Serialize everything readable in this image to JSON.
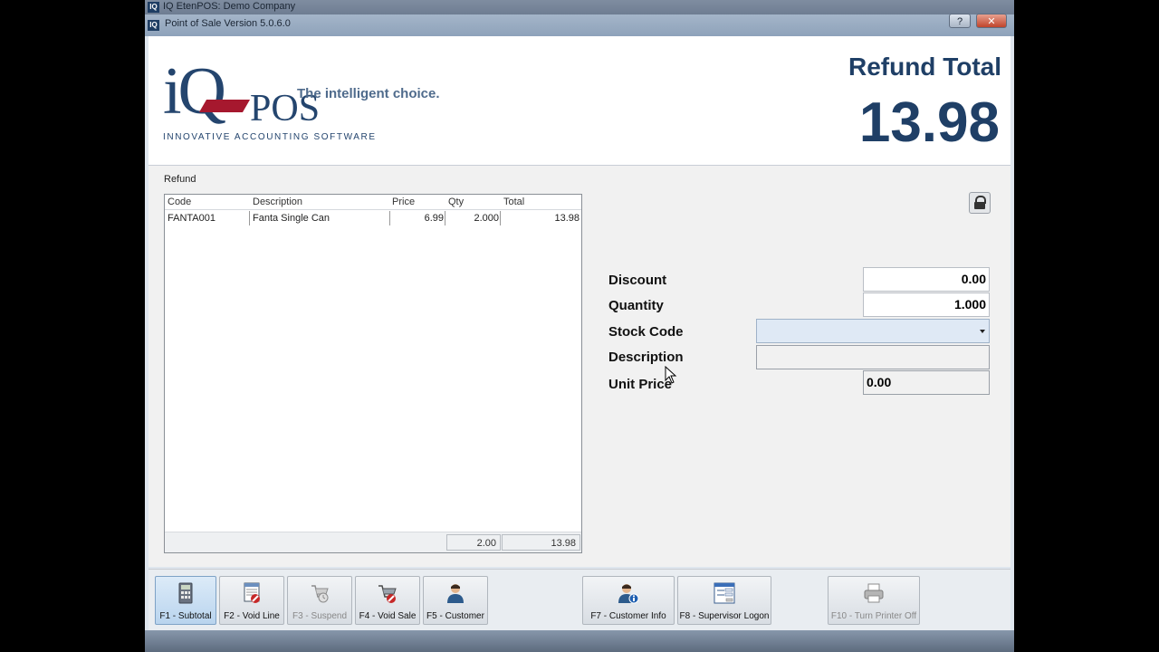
{
  "window": {
    "outer_title": "IQ EtenPOS: Demo Company",
    "inner_title": "Point of Sale Version 5.0.6.0",
    "app_icon_text": "IQ",
    "help_button": "?",
    "close_button": "✕"
  },
  "header": {
    "logo_iq": "iQ",
    "logo_pos": "POS",
    "logo_tagline": "INNOVATIVE ACCOUNTING SOFTWARE",
    "slogan": "The intelligent choice.",
    "refund_label": "Refund Total",
    "refund_amount": "13.98"
  },
  "panel": {
    "section_label": "Refund",
    "grid": {
      "columns": [
        "Code",
        "Description",
        "Price",
        "Qty",
        "Total"
      ],
      "rows": [
        {
          "code": "FANTA001",
          "description": "Fanta Single Can",
          "price": "6.99",
          "qty": "2.000",
          "total": "13.98"
        }
      ],
      "footer_qty": "2.00",
      "footer_total": "13.98"
    }
  },
  "form": {
    "discount_label": "Discount",
    "discount_value": "0.00",
    "quantity_label": "Quantity",
    "quantity_value": "1.000",
    "stock_code_label": "Stock Code",
    "stock_code_value": "",
    "description_label": "Description",
    "description_value": "",
    "unit_price_label": "Unit Price",
    "unit_price_value": "0.00"
  },
  "toolbar": {
    "f1": "F1 - Subtotal",
    "f2": "F2 - Void Line",
    "f3": "F3 - Suspend",
    "f4": "F4 - Void Sale",
    "f5": "F5 - Customer",
    "f7": "F7 - Customer Info",
    "f8": "F8 - Supervisor Logon",
    "f10": "F10 - Turn Printer Off"
  },
  "icons": {
    "f1": "calculator-icon",
    "f2": "void-line-icon",
    "f3": "suspend-icon",
    "f4": "void-sale-icon",
    "f5": "customer-icon",
    "f7": "customer-info-icon",
    "f8": "supervisor-logon-icon",
    "f10": "printer-icon"
  },
  "colors": {
    "brand_navy": "#1f3f66",
    "brand_red": "#a6182e",
    "active_button": "#b9d4ee"
  }
}
